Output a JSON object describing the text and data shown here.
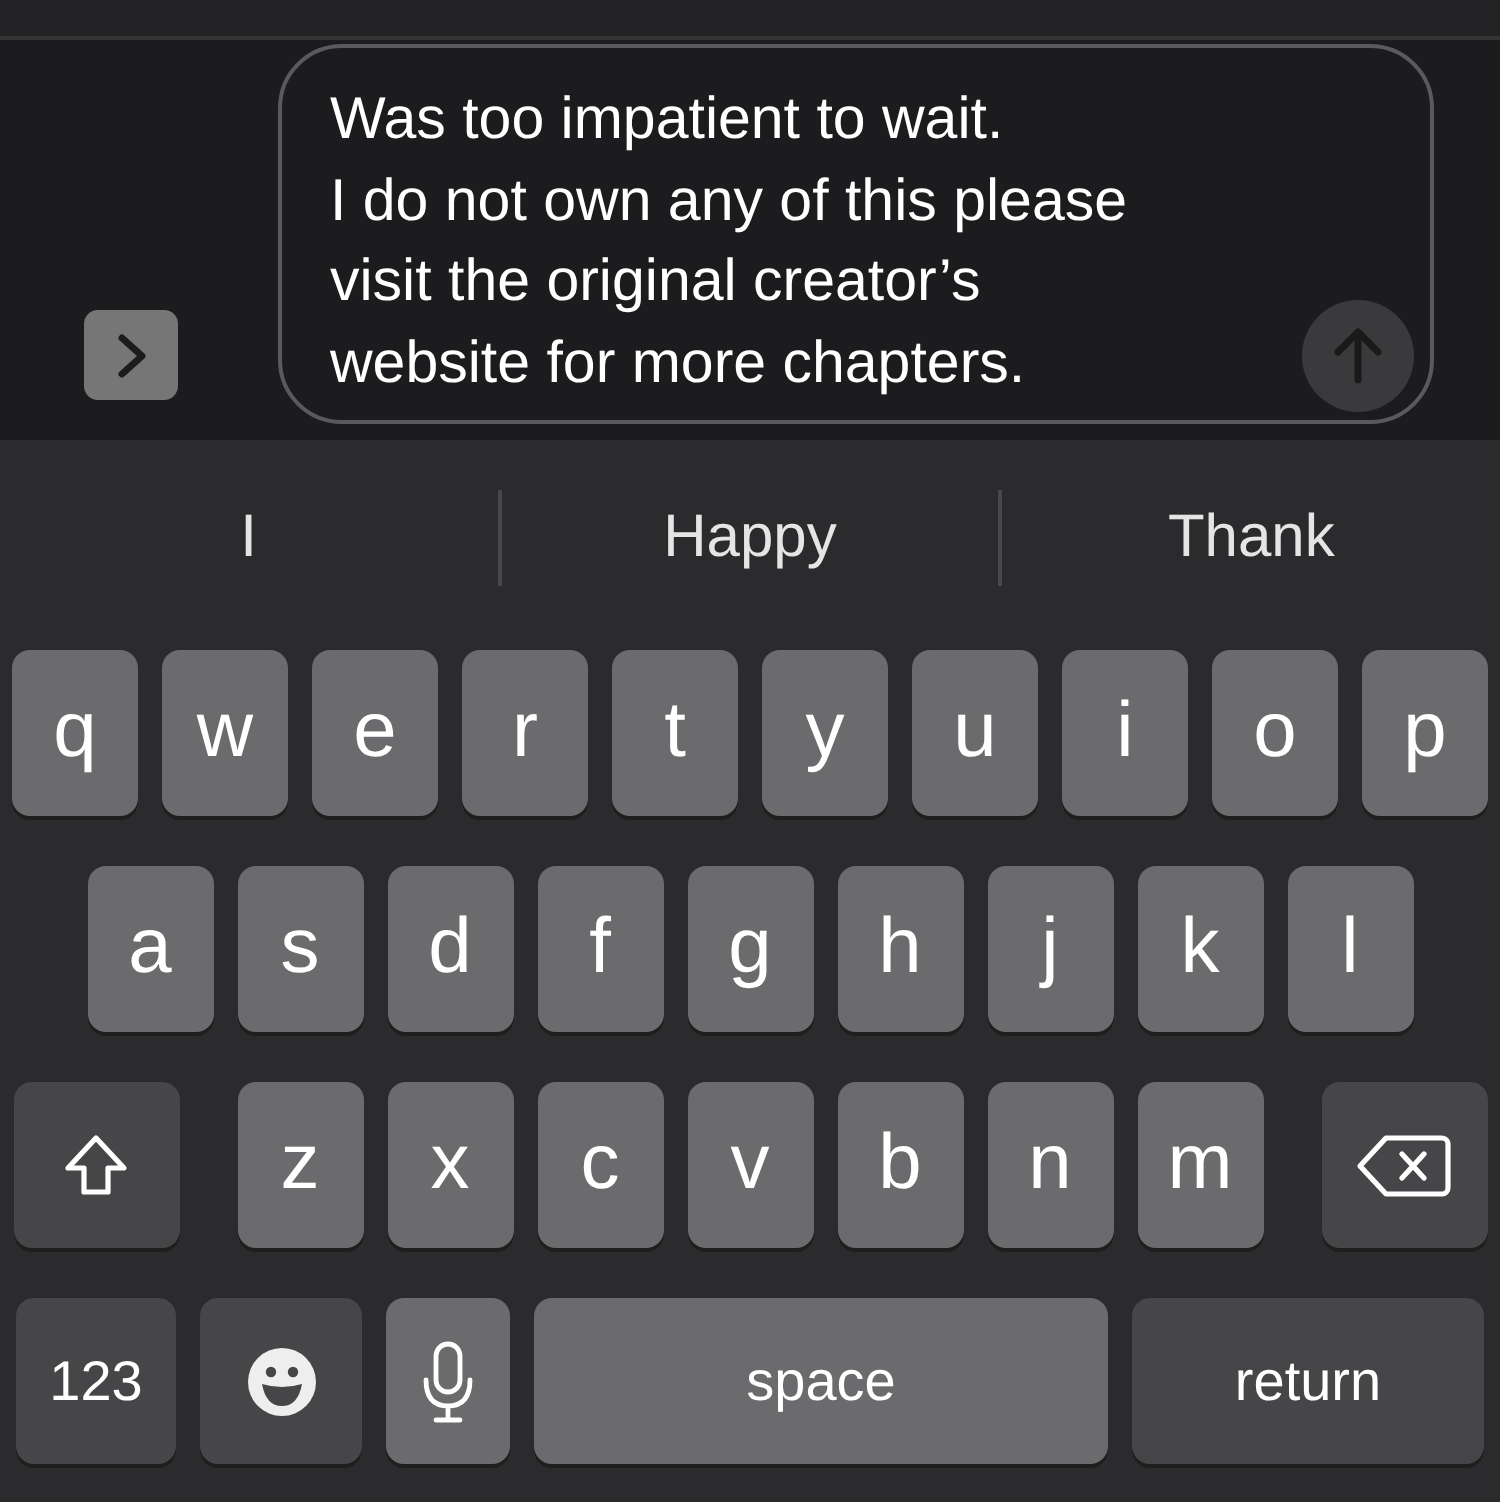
{
  "composer": {
    "message": "Was too impatient to wait.\nI do not own any of this please\nvisit the original creator’s\nwebsite for more chapters."
  },
  "suggestions": [
    "I",
    "Happy",
    "Thank"
  ],
  "keyboard": {
    "rows": [
      {
        "keys": [
          {
            "kind": "letter",
            "label": "q"
          },
          {
            "kind": "letter",
            "label": "w"
          },
          {
            "kind": "letter",
            "label": "e"
          },
          {
            "kind": "letter",
            "label": "r"
          },
          {
            "kind": "letter",
            "label": "t"
          },
          {
            "kind": "letter",
            "label": "y"
          },
          {
            "kind": "letter",
            "label": "u"
          },
          {
            "kind": "letter",
            "label": "i"
          },
          {
            "kind": "letter",
            "label": "o"
          },
          {
            "kind": "letter",
            "label": "p"
          }
        ]
      },
      {
        "keys": [
          {
            "kind": "letter",
            "label": "a"
          },
          {
            "kind": "letter",
            "label": "s"
          },
          {
            "kind": "letter",
            "label": "d"
          },
          {
            "kind": "letter",
            "label": "f"
          },
          {
            "kind": "letter",
            "label": "g"
          },
          {
            "kind": "letter",
            "label": "h"
          },
          {
            "kind": "letter",
            "label": "j"
          },
          {
            "kind": "letter",
            "label": "k"
          },
          {
            "kind": "letter",
            "label": "l"
          }
        ]
      },
      {
        "keys": [
          {
            "kind": "shift"
          },
          {
            "kind": "letter",
            "label": "z"
          },
          {
            "kind": "letter",
            "label": "x"
          },
          {
            "kind": "letter",
            "label": "c"
          },
          {
            "kind": "letter",
            "label": "v"
          },
          {
            "kind": "letter",
            "label": "b"
          },
          {
            "kind": "letter",
            "label": "n"
          },
          {
            "kind": "letter",
            "label": "m"
          },
          {
            "kind": "delete"
          }
        ]
      },
      {
        "keys": [
          {
            "kind": "numbers",
            "label": "123"
          },
          {
            "kind": "emoji"
          },
          {
            "kind": "mic"
          },
          {
            "kind": "space",
            "label": "space"
          },
          {
            "kind": "return",
            "label": "return"
          }
        ]
      }
    ]
  }
}
